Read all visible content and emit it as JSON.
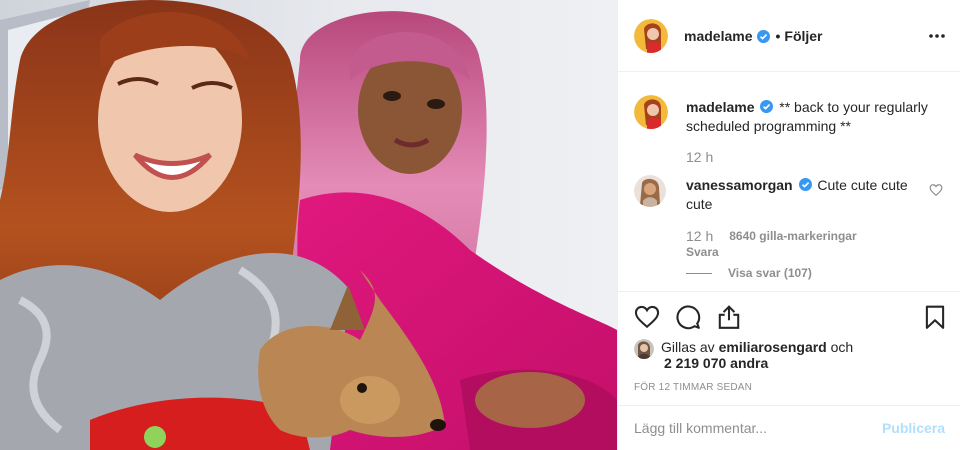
{
  "post": {
    "photo": {
      "description_icon": "photo-of-two-women-and-dog"
    },
    "header": {
      "username": "madelame",
      "verified_icon": "verified-badge-icon",
      "dot": "•",
      "follow_label": "Följer",
      "more_icon": "more-options-icon"
    },
    "caption": {
      "username": "madelame",
      "text": "** back to your regularly scheduled programming **",
      "time": "12 h"
    },
    "comment": {
      "username": "vanessamorgan",
      "text": "Cute cute cute cute",
      "time": "12 h",
      "likes": "8640 gilla-markeringar",
      "reply_label": "Svara",
      "view_replies_label": "Visa svar (107)"
    },
    "actions": {
      "like_icon": "heart-icon",
      "comment_icon": "comment-icon",
      "share_icon": "share-icon",
      "save_icon": "bookmark-icon"
    },
    "liked_by": {
      "prefix": "Gillas av",
      "user": "emiliarosengard",
      "conj": "och",
      "others": "2 219 070 andra"
    },
    "timestamp": "FÖR 12 TIMMAR SEDAN",
    "add_comment": {
      "placeholder": "Lägg till kommentar...",
      "publish_label": "Publicera"
    },
    "colors": {
      "verified": "#3897f0",
      "publish_disabled": "#b2dffc",
      "muted": "#8e8e8e"
    }
  }
}
